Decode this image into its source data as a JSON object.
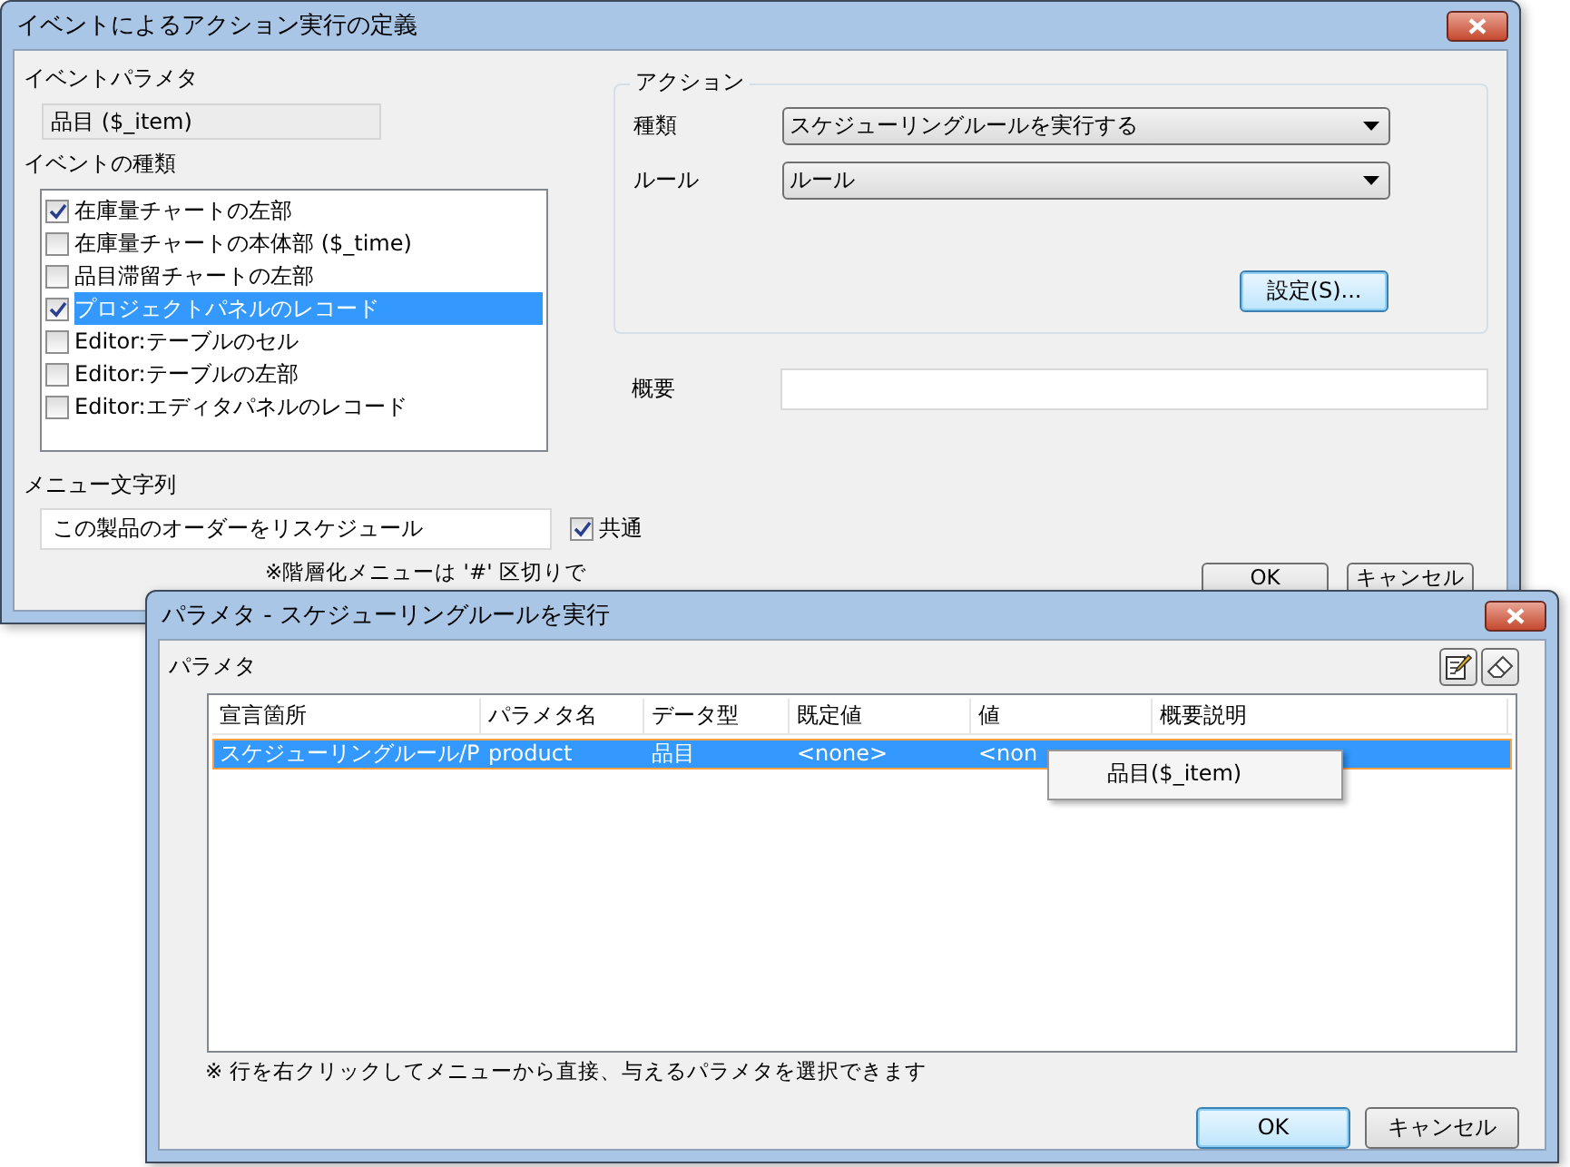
{
  "main_window": {
    "title": "イベントによるアクション実行の定義",
    "event_param_label": "イベントパラメタ",
    "event_param_value": "品目 ($_item)",
    "event_types_label": "イベントの種類",
    "event_types": [
      {
        "label": "在庫量チャートの左部",
        "checked": true,
        "selected": false
      },
      {
        "label": "在庫量チャートの本体部 ($_time)",
        "checked": false,
        "selected": false
      },
      {
        "label": "品目滞留チャートの左部",
        "checked": false,
        "selected": false
      },
      {
        "label": "プロジェクトパネルのレコード",
        "checked": true,
        "selected": true
      },
      {
        "label": "Editor:テーブルのセル",
        "checked": false,
        "selected": false
      },
      {
        "label": "Editor:テーブルの左部",
        "checked": false,
        "selected": false
      },
      {
        "label": "Editor:エディタパネルのレコード",
        "checked": false,
        "selected": false
      }
    ],
    "menu_label": "メニュー文字列",
    "menu_value": "この製品のオーダーをリスケジュール",
    "common": {
      "label": "共通",
      "checked": true
    },
    "menu_note": "※階層化メニューは '#' 区切りで",
    "action": {
      "title": "アクション",
      "fields": [
        {
          "label": "種類",
          "value": "スケジューリングルールを実行する"
        },
        {
          "label": "ルール",
          "value": "ルール"
        }
      ],
      "settings_button": "設定(S)..."
    },
    "summary": {
      "label": "概要"
    },
    "buttons": [
      "OK",
      "キャンセル"
    ]
  },
  "dialog": {
    "title": "パラメタ - スケジューリングルールを実行",
    "section_label": "パラメタ",
    "table": {
      "columns": [
        "宣言箇所",
        "パラメタ名",
        "データ型",
        "既定値",
        "値",
        "概要説明"
      ],
      "rows": [
        {
          "cells": [
            "スケジューリングルール/P",
            "product",
            "品目",
            "<none>",
            "<non"
          ],
          "selected": true
        }
      ]
    },
    "context_menu": {
      "items": [
        "品目($_item)"
      ]
    },
    "note": "※ 行を右クリックしてメニューから直接、与えるパラメタを選択できます",
    "buttons": [
      "OK",
      "キャンセル"
    ]
  }
}
